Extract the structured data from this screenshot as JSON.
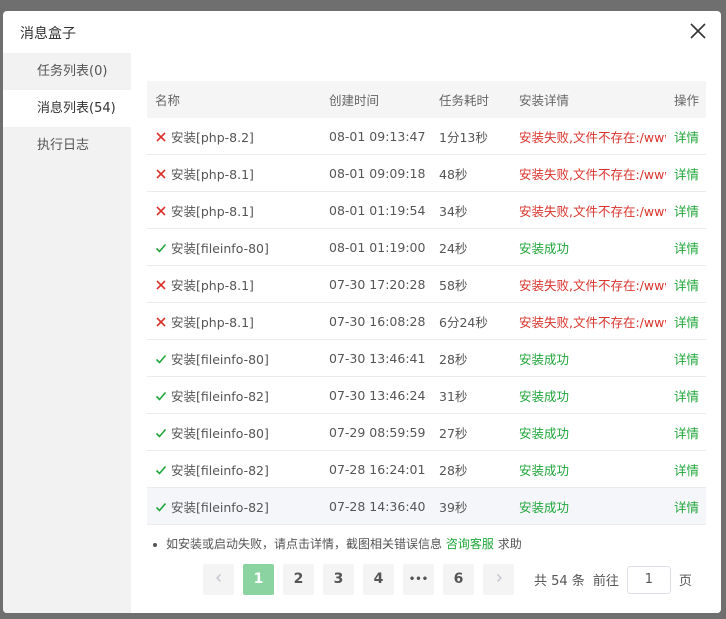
{
  "dialog": {
    "title": "消息盒子"
  },
  "sidebar": {
    "items": [
      {
        "label": "任务列表(0)"
      },
      {
        "label": "消息列表(54)"
      },
      {
        "label": "执行日志"
      }
    ]
  },
  "table": {
    "headers": [
      "名称",
      "创建时间",
      "任务耗时",
      "安装详情",
      "操作"
    ],
    "rows": [
      {
        "status": "fail",
        "name": "安装[php-8.2]",
        "time": "08-01 09:13:47",
        "duration": "1分13秒",
        "detail": "安装失败,文件不存在:/www",
        "action": "详情"
      },
      {
        "status": "fail",
        "name": "安装[php-8.1]",
        "time": "08-01 09:09:18",
        "duration": "48秒",
        "detail": "安装失败,文件不存在:/www",
        "action": "详情"
      },
      {
        "status": "fail",
        "name": "安装[php-8.1]",
        "time": "08-01 01:19:54",
        "duration": "34秒",
        "detail": "安装失败,文件不存在:/www",
        "action": "详情"
      },
      {
        "status": "ok",
        "name": "安装[fileinfo-80]",
        "time": "08-01 01:19:00",
        "duration": "24秒",
        "detail": "安装成功",
        "action": "详情"
      },
      {
        "status": "fail",
        "name": "安装[php-8.1]",
        "time": "07-30 17:20:28",
        "duration": "58秒",
        "detail": "安装失败,文件不存在:/www",
        "action": "详情"
      },
      {
        "status": "fail",
        "name": "安装[php-8.1]",
        "time": "07-30 16:08:28",
        "duration": "6分24秒",
        "detail": "安装失败,文件不存在:/www",
        "action": "详情"
      },
      {
        "status": "ok",
        "name": "安装[fileinfo-80]",
        "time": "07-30 13:46:41",
        "duration": "28秒",
        "detail": "安装成功",
        "action": "详情"
      },
      {
        "status": "ok",
        "name": "安装[fileinfo-82]",
        "time": "07-30 13:46:24",
        "duration": "31秒",
        "detail": "安装成功",
        "action": "详情"
      },
      {
        "status": "ok",
        "name": "安装[fileinfo-80]",
        "time": "07-29 08:59:59",
        "duration": "27秒",
        "detail": "安装成功",
        "action": "详情"
      },
      {
        "status": "ok",
        "name": "安装[fileinfo-82]",
        "time": "07-28 16:24:01",
        "duration": "28秒",
        "detail": "安装成功",
        "action": "详情"
      },
      {
        "status": "ok",
        "name": "安装[fileinfo-82]",
        "time": "07-28 14:36:40",
        "duration": "39秒",
        "detail": "安装成功",
        "action": "详情"
      }
    ]
  },
  "note": {
    "text": "如安装或启动失败，请点击详情，截图相关错误信息",
    "link": "咨询客服",
    "suffix": "求助"
  },
  "pagination": {
    "pages": [
      "1",
      "2",
      "3",
      "4",
      "•••",
      "6"
    ],
    "current": "1",
    "total": "共 54 条",
    "goto": "前往",
    "input_value": "1",
    "page_unit": "页"
  },
  "colors": {
    "fail": "#d9332c",
    "success": "#20a53a",
    "active_page": "#8bd3a0"
  }
}
